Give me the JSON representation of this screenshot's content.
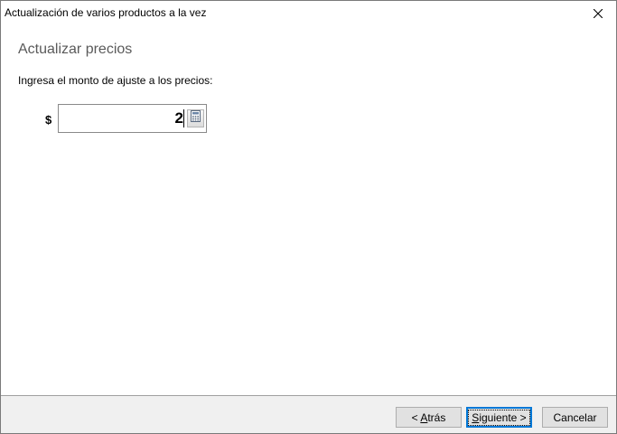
{
  "window": {
    "title": "Actualización de varios productos a la vez"
  },
  "content": {
    "heading": "Actualizar precios",
    "prompt": "Ingresa el monto de ajuste a los precios:",
    "currency_symbol": "$",
    "amount_value": "2"
  },
  "footer": {
    "back": {
      "mnemonic_pre": "< ",
      "mnemonic": "A",
      "rest": "trás"
    },
    "next": {
      "mnemonic": "S",
      "rest": "iguiente >"
    },
    "cancel_label": "Cancelar"
  },
  "icons": {
    "close": "close-icon",
    "calculator": "calculator-icon"
  },
  "colors": {
    "accent": "#0078d7",
    "heading": "#5a5a5a",
    "footer_bg": "#f0f0f0"
  }
}
